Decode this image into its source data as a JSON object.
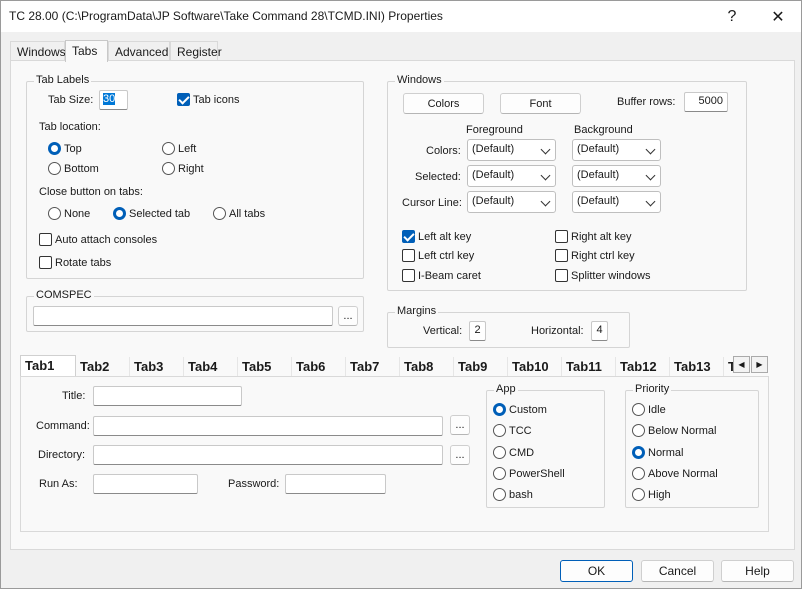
{
  "window": {
    "title": "TC 28.00  (C:\\ProgramData\\JP Software\\Take Command 28\\TCMD.INI)  Properties",
    "help_glyph": "?",
    "close_glyph": "✕"
  },
  "tabs": [
    {
      "label": "Windows"
    },
    {
      "label": "Tabs"
    },
    {
      "label": "Advanced"
    },
    {
      "label": "Register"
    }
  ],
  "tab_labels": {
    "group": "Tab Labels",
    "tab_size_label": "Tab Size:",
    "tab_size_value": "30",
    "tab_icons": "Tab icons",
    "tab_location_label": "Tab location:",
    "locations": {
      "top": "Top",
      "left": "Left",
      "bottom": "Bottom",
      "right": "Right"
    },
    "close_button_label": "Close button on tabs:",
    "close_options": {
      "none": "None",
      "selected": "Selected tab",
      "all": "All tabs"
    },
    "auto_attach": "Auto attach consoles",
    "rotate_tabs": "Rotate tabs"
  },
  "comspec": {
    "group": "COMSPEC",
    "value": "",
    "browse": "..."
  },
  "windows_group": {
    "group": "Windows",
    "colors_btn": "Colors",
    "font_btn": "Font",
    "buffer_rows_label": "Buffer rows:",
    "buffer_rows_value": "5000",
    "foreground_label": "Foreground",
    "background_label": "Background",
    "rows": [
      {
        "label": "Colors:",
        "fg": "(Default)",
        "bg": "(Default)"
      },
      {
        "label": "Selected:",
        "fg": "(Default)",
        "bg": "(Default)"
      },
      {
        "label": "Cursor Line:",
        "fg": "(Default)",
        "bg": "(Default)"
      }
    ],
    "left_alt": "Left alt key",
    "right_alt": "Right alt key",
    "left_ctrl": "Left ctrl key",
    "right_ctrl": "Right ctrl key",
    "ibeam": "I-Beam caret",
    "splitter": "Splitter windows"
  },
  "margins": {
    "group": "Margins",
    "vertical_label": "Vertical:",
    "vertical_value": "2",
    "horizontal_label": "Horizontal:",
    "horizontal_value": "4"
  },
  "subtabs": [
    "Tab1",
    "Tab2",
    "Tab3",
    "Tab4",
    "Tab5",
    "Tab6",
    "Tab7",
    "Tab8",
    "Tab9",
    "Tab10",
    "Tab11",
    "Tab12",
    "Tab13",
    "T"
  ],
  "scroll": {
    "left": "◀",
    "right": "▶"
  },
  "tab_props": {
    "title_label": "Title:",
    "title_value": "",
    "command_label": "Command:",
    "command_value": "",
    "directory_label": "Directory:",
    "directory_value": "",
    "runas_label": "Run As:",
    "runas_value": "",
    "password_label": "Password:",
    "password_value": "",
    "browse": "..."
  },
  "app": {
    "group": "App",
    "options": [
      "Custom",
      "TCC",
      "CMD",
      "PowerShell",
      "bash"
    ]
  },
  "priority": {
    "group": "Priority",
    "options": [
      "Idle",
      "Below Normal",
      "Normal",
      "Above Normal",
      "High"
    ]
  },
  "buttons": {
    "ok": "OK",
    "cancel": "Cancel",
    "help": "Help"
  }
}
